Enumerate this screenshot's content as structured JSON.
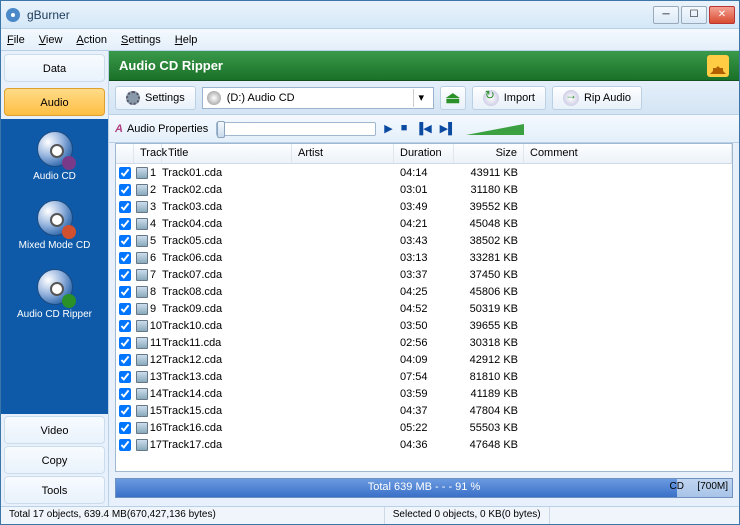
{
  "window": {
    "title": "gBurner"
  },
  "menu": {
    "file": "File",
    "view": "View",
    "action": "Action",
    "settings": "Settings",
    "help": "Help"
  },
  "sidebar": {
    "tabs": {
      "data": "Data",
      "audio": "Audio",
      "video": "Video",
      "copy": "Copy",
      "tools": "Tools"
    },
    "items": [
      {
        "label": "Audio CD"
      },
      {
        "label": "Mixed Mode CD"
      },
      {
        "label": "Audio CD Ripper"
      }
    ]
  },
  "header": {
    "title": "Audio CD Ripper"
  },
  "toolbar": {
    "settings": "Settings",
    "drive": "(D:) Audio CD",
    "import": "Import",
    "rip": "Rip Audio",
    "audio_properties": "Audio Properties"
  },
  "columns": {
    "track": "Track",
    "title": "Title",
    "artist": "Artist",
    "duration": "Duration",
    "size": "Size",
    "comment": "Comment"
  },
  "tracks": [
    {
      "n": "1",
      "title": "Track01.cda",
      "artist": "",
      "dur": "04:14",
      "size": "43911 KB",
      "comment": ""
    },
    {
      "n": "2",
      "title": "Track02.cda",
      "artist": "",
      "dur": "03:01",
      "size": "31180 KB",
      "comment": ""
    },
    {
      "n": "3",
      "title": "Track03.cda",
      "artist": "",
      "dur": "03:49",
      "size": "39552 KB",
      "comment": ""
    },
    {
      "n": "4",
      "title": "Track04.cda",
      "artist": "",
      "dur": "04:21",
      "size": "45048 KB",
      "comment": ""
    },
    {
      "n": "5",
      "title": "Track05.cda",
      "artist": "",
      "dur": "03:43",
      "size": "38502 KB",
      "comment": ""
    },
    {
      "n": "6",
      "title": "Track06.cda",
      "artist": "",
      "dur": "03:13",
      "size": "33281 KB",
      "comment": ""
    },
    {
      "n": "7",
      "title": "Track07.cda",
      "artist": "",
      "dur": "03:37",
      "size": "37450 KB",
      "comment": ""
    },
    {
      "n": "8",
      "title": "Track08.cda",
      "artist": "",
      "dur": "04:25",
      "size": "45806 KB",
      "comment": ""
    },
    {
      "n": "9",
      "title": "Track09.cda",
      "artist": "",
      "dur": "04:52",
      "size": "50319 KB",
      "comment": ""
    },
    {
      "n": "10",
      "title": "Track10.cda",
      "artist": "",
      "dur": "03:50",
      "size": "39655 KB",
      "comment": ""
    },
    {
      "n": "11",
      "title": "Track11.cda",
      "artist": "",
      "dur": "02:56",
      "size": "30318 KB",
      "comment": ""
    },
    {
      "n": "12",
      "title": "Track12.cda",
      "artist": "",
      "dur": "04:09",
      "size": "42912 KB",
      "comment": ""
    },
    {
      "n": "13",
      "title": "Track13.cda",
      "artist": "",
      "dur": "07:54",
      "size": "81810 KB",
      "comment": ""
    },
    {
      "n": "14",
      "title": "Track14.cda",
      "artist": "",
      "dur": "03:59",
      "size": "41189 KB",
      "comment": ""
    },
    {
      "n": "15",
      "title": "Track15.cda",
      "artist": "",
      "dur": "04:37",
      "size": "47804 KB",
      "comment": ""
    },
    {
      "n": "16",
      "title": "Track16.cda",
      "artist": "",
      "dur": "05:22",
      "size": "55503 KB",
      "comment": ""
    },
    {
      "n": "17",
      "title": "Track17.cda",
      "artist": "",
      "dur": "04:36",
      "size": "47648 KB",
      "comment": ""
    }
  ],
  "progress": {
    "text": "Total  639 MB   - - -  91 %",
    "cd": "CD",
    "cap": "[700M]"
  },
  "status": {
    "left": "Total 17 objects, 639.4 MB(670,427,136 bytes)",
    "right": "Selected 0 objects, 0 KB(0 bytes)"
  }
}
